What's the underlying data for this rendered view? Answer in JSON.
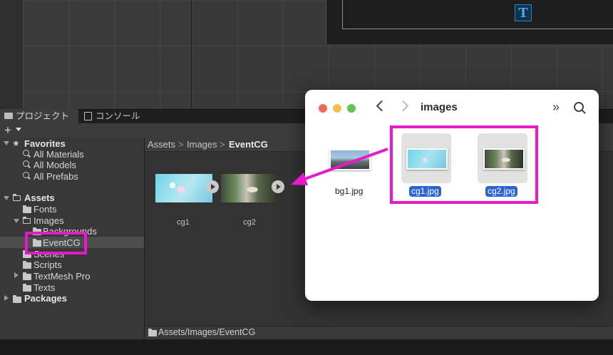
{
  "tabs": {
    "project": "プロジェクト",
    "console": "コンソール"
  },
  "toolbar": {
    "add": "+"
  },
  "tree": {
    "favorites": "Favorites",
    "fav_items": [
      "All Materials",
      "All Models",
      "All Prefabs"
    ],
    "assets": "Assets",
    "fonts": "Fonts",
    "images": "Images",
    "backgrounds": "Backgrounds",
    "eventcg": "EventCG",
    "scenes": "Scenes",
    "scripts": "Scripts",
    "textmesh": "TextMesh Pro",
    "texts": "Texts",
    "packages": "Packages"
  },
  "breadcrumb": {
    "a": "Assets",
    "b": "Images",
    "c": "EventCG",
    "sep": ">"
  },
  "assets": [
    {
      "label": "cg1"
    },
    {
      "label": "cg2"
    }
  ],
  "path": "Assets/Images/EventCG",
  "finder": {
    "title": "images",
    "chevrons": "»",
    "files": [
      {
        "name": "bg1.jpg"
      },
      {
        "name": "cg1.jpg"
      },
      {
        "name": "cg2.jpg"
      }
    ]
  },
  "colors": {
    "highlight": "#e61ac9",
    "selection": "#2c64d4"
  }
}
